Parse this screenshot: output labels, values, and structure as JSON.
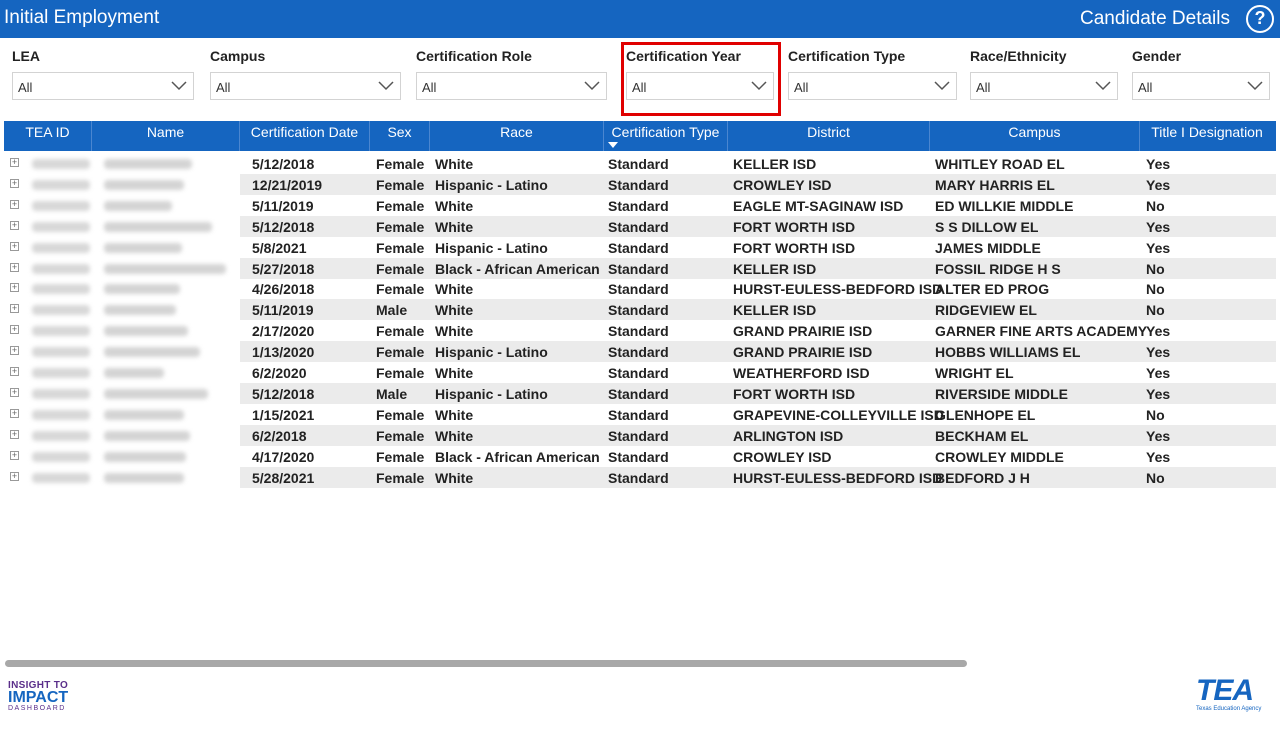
{
  "header": {
    "title": "Initial Employment",
    "details_link": "Candidate Details",
    "help_icon": "help-circle-icon"
  },
  "filters": [
    {
      "label": "LEA",
      "value": "All"
    },
    {
      "label": "Campus",
      "value": "All"
    },
    {
      "label": "Certification Role",
      "value": "All"
    },
    {
      "label": "Certification Year",
      "value": "All"
    },
    {
      "label": "Certification Type",
      "value": "All"
    },
    {
      "label": "Race/Ethnicity",
      "value": "All"
    },
    {
      "label": "Gender",
      "value": "All"
    }
  ],
  "table": {
    "columns": [
      "TEA ID",
      "Name",
      "Certification Date",
      "Sex",
      "Race",
      "Certification Type",
      "District",
      "Campus",
      "Title I Designation"
    ],
    "sorted_column": "Certification Type",
    "rows": [
      [
        "5/12/2018",
        "Female",
        "White",
        "Standard",
        "KELLER ISD",
        "WHITLEY ROAD EL",
        "Yes"
      ],
      [
        "12/21/2019",
        "Female",
        "Hispanic - Latino",
        "Standard",
        "CROWLEY ISD",
        "MARY HARRIS EL",
        "Yes"
      ],
      [
        "5/11/2019",
        "Female",
        "White",
        "Standard",
        "EAGLE MT-SAGINAW ISD",
        "ED WILLKIE MIDDLE",
        "No"
      ],
      [
        "5/12/2018",
        "Female",
        "White",
        "Standard",
        "FORT WORTH ISD",
        "S S DILLOW EL",
        "Yes"
      ],
      [
        "5/8/2021",
        "Female",
        "Hispanic - Latino",
        "Standard",
        "FORT WORTH ISD",
        "JAMES MIDDLE",
        "Yes"
      ],
      [
        "5/27/2018",
        "Female",
        "Black - African American",
        "Standard",
        "KELLER ISD",
        "FOSSIL RIDGE H S",
        "No"
      ],
      [
        "4/26/2018",
        "Female",
        "White",
        "Standard",
        "HURST-EULESS-BEDFORD ISD",
        "ALTER ED PROG",
        "No"
      ],
      [
        "5/11/2019",
        "Male",
        "White",
        "Standard",
        "KELLER ISD",
        "RIDGEVIEW EL",
        "No"
      ],
      [
        "2/17/2020",
        "Female",
        "White",
        "Standard",
        "GRAND PRAIRIE ISD",
        "GARNER FINE ARTS ACADEMY",
        "Yes"
      ],
      [
        "1/13/2020",
        "Female",
        "Hispanic - Latino",
        "Standard",
        "GRAND PRAIRIE ISD",
        "HOBBS WILLIAMS EL",
        "Yes"
      ],
      [
        "6/2/2020",
        "Female",
        "White",
        "Standard",
        "WEATHERFORD ISD",
        "WRIGHT EL",
        "Yes"
      ],
      [
        "5/12/2018",
        "Male",
        "Hispanic - Latino",
        "Standard",
        "FORT WORTH ISD",
        "RIVERSIDE MIDDLE",
        "Yes"
      ],
      [
        "1/15/2021",
        "Female",
        "White",
        "Standard",
        "GRAPEVINE-COLLEYVILLE ISD",
        "GLENHOPE EL",
        "No"
      ],
      [
        "6/2/2018",
        "Female",
        "White",
        "Standard",
        "ARLINGTON ISD",
        "BECKHAM EL",
        "Yes"
      ],
      [
        "4/17/2020",
        "Female",
        "Black - African American",
        "Standard",
        "CROWLEY ISD",
        "CROWLEY MIDDLE",
        "Yes"
      ],
      [
        "5/28/2021",
        "Female",
        "White",
        "Standard",
        "HURST-EULESS-BEDFORD ISD",
        "BEDFORD J H",
        "No"
      ]
    ]
  },
  "logos": {
    "left": {
      "line1": "INSIGHT TO",
      "line2": "IMPACT",
      "line3": "DASHBOARD"
    },
    "right": {
      "mark": "TEA",
      "sub": "Texas Education Agency"
    }
  },
  "colors": {
    "header": "#1565c0",
    "highlight": "#e00000",
    "row_alt": "#ebebeb"
  }
}
